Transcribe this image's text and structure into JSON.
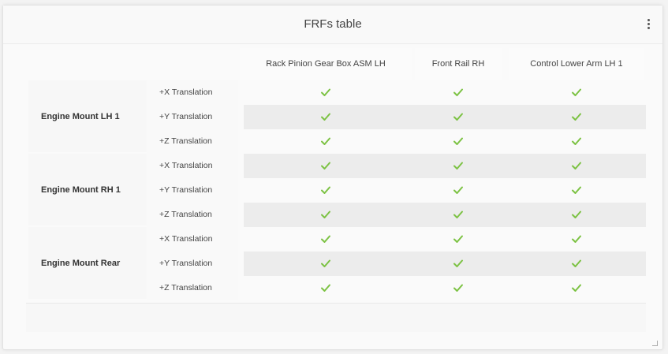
{
  "panel": {
    "title": "FRFs table",
    "menu_icon": "vertical-ellipsis-icon"
  },
  "table": {
    "columns": [
      "Rack Pinion Gear Box ASM LH",
      "Front Rail RH",
      "Control Lower Arm LH 1"
    ],
    "groups": [
      {
        "label": "Engine Mount LH 1",
        "rows": [
          {
            "dof": "+X Translation",
            "values": [
              true,
              true,
              true
            ]
          },
          {
            "dof": "+Y Translation",
            "values": [
              true,
              true,
              true
            ]
          },
          {
            "dof": "+Z Translation",
            "values": [
              true,
              true,
              true
            ]
          }
        ]
      },
      {
        "label": "Engine Mount RH 1",
        "rows": [
          {
            "dof": "+X Translation",
            "values": [
              true,
              true,
              true
            ]
          },
          {
            "dof": "+Y Translation",
            "values": [
              true,
              true,
              true
            ]
          },
          {
            "dof": "+Z Translation",
            "values": [
              true,
              true,
              true
            ]
          }
        ]
      },
      {
        "label": "Engine Mount Rear",
        "rows": [
          {
            "dof": "+X Translation",
            "values": [
              true,
              true,
              true
            ]
          },
          {
            "dof": "+Y Translation",
            "values": [
              true,
              true,
              true
            ]
          },
          {
            "dof": "+Z Translation",
            "values": [
              true,
              true,
              true
            ]
          }
        ]
      }
    ]
  },
  "colors": {
    "check": "#7cc243",
    "shade": "#ececec"
  },
  "icons": {
    "check": "check-icon",
    "resize": "resize-handle-icon"
  }
}
